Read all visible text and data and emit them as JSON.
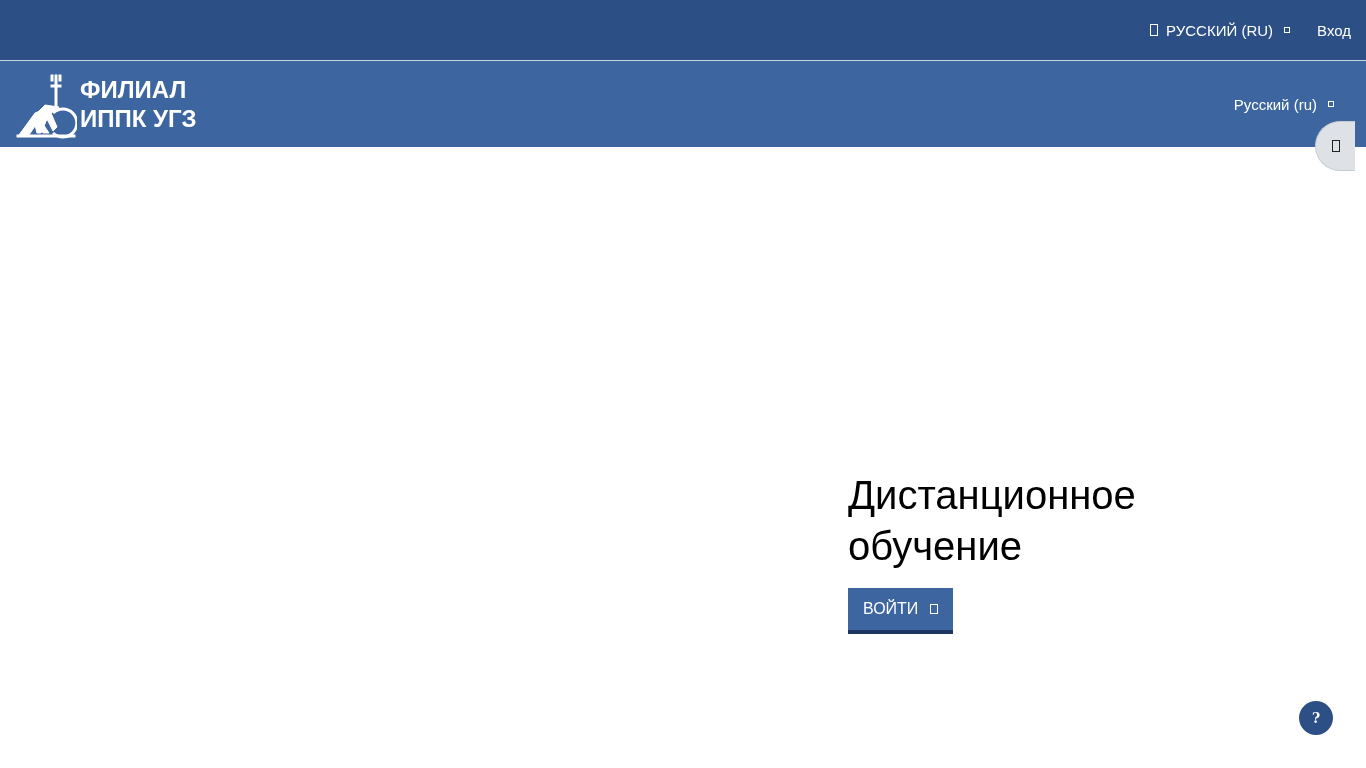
{
  "top_bar": {
    "language": "РУССКИЙ (RU)",
    "login": "Вход"
  },
  "nav_bar": {
    "logo_lines": [
      "ФИЛИАЛ",
      "ИППК УГЗ"
    ],
    "language": "Русский (ru)"
  },
  "hero": {
    "title": "Дистанционное обучение",
    "button": "ВОЙТИ"
  },
  "help_button": "?"
}
